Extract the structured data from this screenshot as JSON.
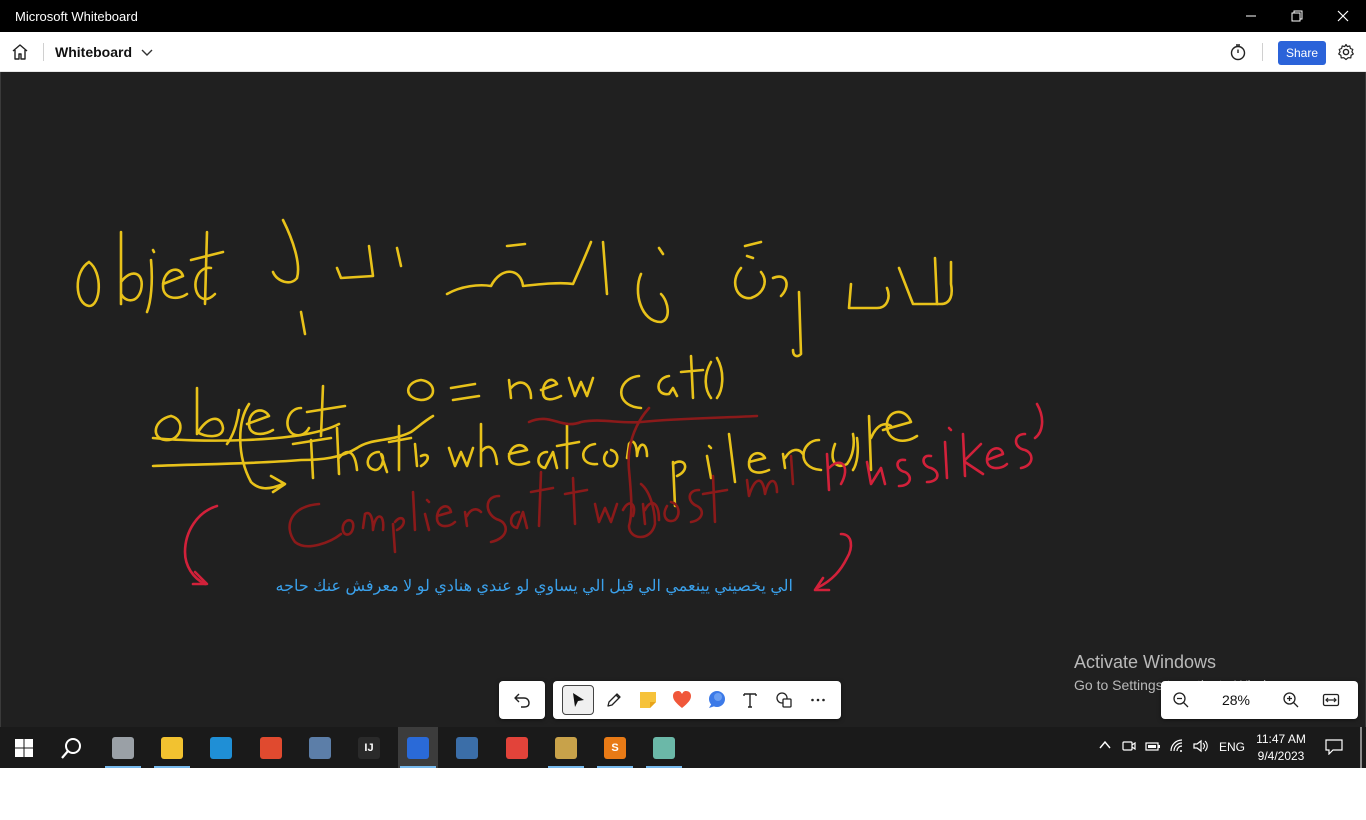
{
  "window": {
    "title": "Microsoft Whiteboard",
    "controls": [
      "minimize-icon",
      "restore-icon",
      "close-icon"
    ]
  },
  "appbar": {
    "home_icon": "home-icon",
    "board_name": "Whiteboard",
    "timer_icon": "timer-icon",
    "share_label": "Share",
    "settings_icon": "gear-icon"
  },
  "canvas": {
    "background": "#202020",
    "ink_colors": {
      "yellow": "#e8c21a",
      "dark_red": "#8b1a1a",
      "red": "#d2213a"
    },
    "arabic_note": "الي يخصيني يينعمي الي قبل الي يساوي لو عندي هنادي لو لا معرفش عنك حاجه",
    "arabic_note_color": "#3aa0ea"
  },
  "watermark": {
    "line1": "Activate Windows",
    "line2": "Go to Settings to activate Windows."
  },
  "toolbar": {
    "tools": [
      {
        "name": "undo-icon"
      },
      {
        "name": "select-arrow-icon",
        "active": true
      },
      {
        "name": "pen-icon"
      },
      {
        "name": "sticky-note-icon"
      },
      {
        "name": "reaction-heart-icon"
      },
      {
        "name": "comment-bubble-icon"
      },
      {
        "name": "text-icon"
      },
      {
        "name": "shapes-icon"
      },
      {
        "name": "more-icon"
      }
    ]
  },
  "zoom": {
    "value": "28%",
    "zoom_out_icon": "zoom-out-icon",
    "zoom_in_icon": "zoom-in-icon",
    "fit_icon": "fit-to-screen-icon"
  },
  "taskbar": {
    "apps": [
      {
        "name": "clock-app-icon",
        "color": "#9aa0a6",
        "running": true
      },
      {
        "name": "file-explorer-icon",
        "color": "#f2c230",
        "running": true
      },
      {
        "name": "edge-icon",
        "color": "#1f8fd6",
        "running": false
      },
      {
        "name": "office-app-icon",
        "color": "#e04a2f",
        "running": false
      },
      {
        "name": "calculator-icon",
        "color": "#5c7ea8",
        "running": false
      },
      {
        "name": "intellij-icon",
        "color": "#2a2a2a",
        "label": "IJ",
        "running": false
      },
      {
        "name": "whiteboard-app-icon",
        "color": "#2a6ad8",
        "running": true,
        "current": true
      },
      {
        "name": "virtualbox-icon",
        "color": "#3b6ea8",
        "running": false
      },
      {
        "name": "chrome-icon",
        "color": "#e2433a",
        "running": false
      },
      {
        "name": "paint-icon",
        "color": "#c8a24a",
        "running": true
      },
      {
        "name": "sublime-text-icon",
        "color": "#e87a16",
        "label": "S",
        "running": true
      },
      {
        "name": "app-cube-icon",
        "color": "#6bb8a8",
        "running": true
      }
    ],
    "language": "ENG",
    "time": "11:47 AM",
    "date": "9/4/2023"
  }
}
